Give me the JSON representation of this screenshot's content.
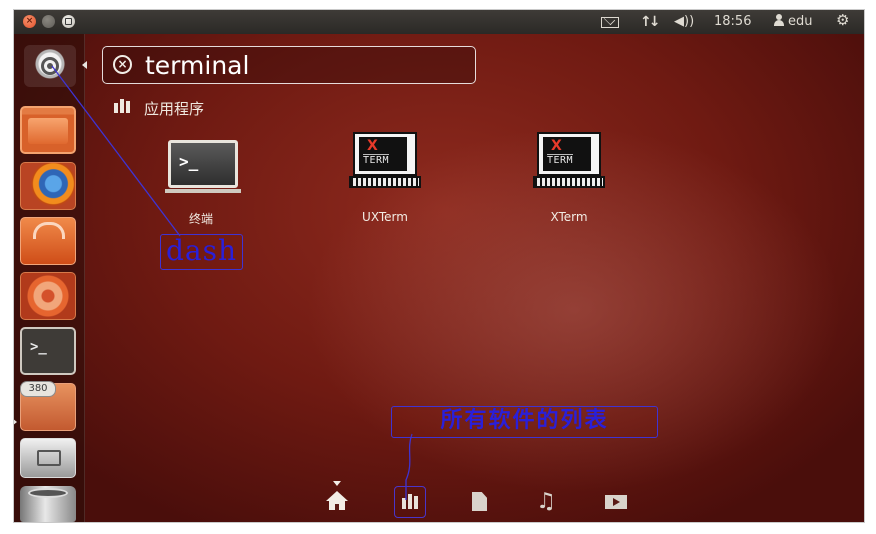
{
  "window_controls": {
    "close_glyph": "×"
  },
  "top_panel": {
    "icons": [
      "mail-icon",
      "network-icon",
      "sound-icon",
      "user-icon",
      "session-gear-icon"
    ],
    "network_glyph": "↑↓",
    "sound_glyph": "◀))",
    "clock": "18:56",
    "user": "edu",
    "gear_glyph": "⚙"
  },
  "launcher": {
    "items": [
      "dash-home",
      "files",
      "firefox",
      "software-center",
      "system-settings",
      "terminal",
      "update-manager",
      "workspace-switcher",
      "trash"
    ],
    "update_badge": "380"
  },
  "dash": {
    "search": {
      "value": "terminal",
      "clear_glyph": "×"
    },
    "category": "应用程序",
    "results": [
      {
        "label": "终端",
        "icon": "terminal-icon"
      },
      {
        "label": "UXTerm",
        "icon": "xterm-icon"
      },
      {
        "label": "XTerm",
        "icon": "xterm-icon"
      }
    ],
    "xterm_icon_x": "X",
    "xterm_icon_text": "TERM",
    "lenses": [
      "home-lens",
      "applications-lens",
      "files-lens",
      "music-lens",
      "video-lens"
    ],
    "music_glyph": "♫"
  },
  "annotations": {
    "dash_label": "dash",
    "all_software_label": "所有软件的列表",
    "color": "#2a1fd9"
  },
  "colors": {
    "background": "#6f1a12",
    "panel": "#3e3b37",
    "accent_close": "#e0502c"
  }
}
